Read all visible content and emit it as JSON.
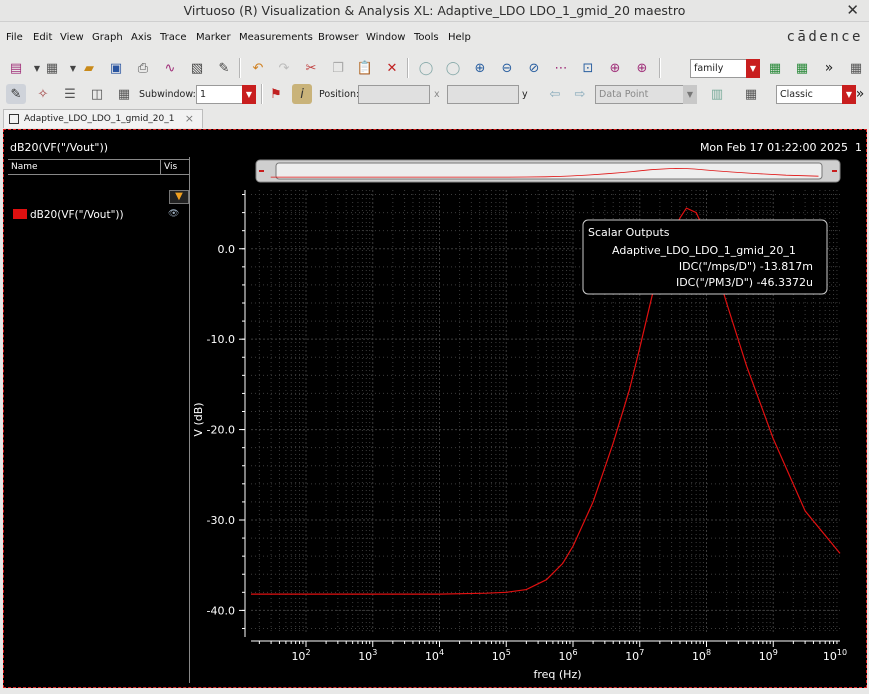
{
  "window": {
    "title": "Virtuoso (R) Visualization & Analysis XL: Adaptive_LDO LDO_1_gmid_20 maestro",
    "close_glyph": "✕"
  },
  "menu": {
    "items": [
      "File",
      "Edit",
      "View",
      "Graph",
      "Axis",
      "Trace",
      "Marker",
      "Measurements",
      "Browser",
      "Window",
      "Tools",
      "Help"
    ],
    "brand": "cādence"
  },
  "toolbar": {
    "family_combo": "family",
    "subwindow_label": "Subwindow:",
    "subwindow_value": "1",
    "position_label": "Position:",
    "x_label": "x",
    "y_label": "y",
    "marker_combo": "Data Point",
    "style_combo": "Classic",
    "overflow": "»"
  },
  "tab": {
    "label": "Adaptive_LDO_LDO_1_gmid_20_1",
    "close": "×"
  },
  "panel": {
    "header": "dB20(VF(\"/Vout\"))",
    "datetime": "Mon Feb 17 01:22:00 2025",
    "index": "1",
    "col_name": "Name",
    "col_vis": "Vis",
    "trace_name": "dB20(VF(\"/Vout\"))"
  },
  "scalar_outputs": {
    "title": "Scalar Outputs",
    "test": "Adaptive_LDO_LDO_1_gmid_20_1",
    "rows": [
      "IDC(\"/mps/D\") -13.817m",
      "IDC(\"/PM3/D\") -46.3372u"
    ]
  },
  "chart_data": {
    "type": "line",
    "title": "",
    "xlabel": "freq (Hz)",
    "ylabel": "V (dB)",
    "x_scale": "log",
    "xlim": [
      15,
      10000000000.0
    ],
    "ylim": [
      -42.5,
      6.5
    ],
    "x_ticks": [
      100.0,
      1000.0,
      10000.0,
      100000.0,
      1000000.0,
      10000000.0,
      100000000.0,
      1000000000.0,
      10000000000.0
    ],
    "x_tick_exponents": [
      "2",
      "3",
      "4",
      "5",
      "6",
      "7",
      "8",
      "9",
      "10"
    ],
    "x_tick_base": "10",
    "y_ticks": [
      0,
      -10,
      -20,
      -30,
      -40
    ],
    "y_tick_labels": [
      "0.0",
      "-10.0",
      "-20.0",
      "-30.0",
      "-40.0"
    ],
    "grid": true,
    "colors": {
      "background": "#000000",
      "trace": "#e01010",
      "axis": "#ffffff",
      "grid": "#3c3c3c"
    },
    "series": [
      {
        "name": "dB20(VF(\"/Vout\"))",
        "x": [
          15,
          100,
          1000,
          10000,
          50000,
          100000,
          200000,
          400000,
          700000,
          1000000,
          2000000,
          4000000,
          7000000,
          10000000,
          20000000,
          40000000,
          50000000,
          70000000,
          100000000,
          200000000,
          400000000,
          1000000000,
          3000000000,
          10000000000
        ],
        "y": [
          -38.2,
          -38.2,
          -38.2,
          -38.2,
          -38.1,
          -38.0,
          -37.7,
          -36.6,
          -34.8,
          -32.9,
          -28.0,
          -21.5,
          -15.6,
          -11.0,
          -1.6,
          3.4,
          4.5,
          4.0,
          1.5,
          -6.0,
          -13.0,
          -21.0,
          -29.0,
          -33.7
        ]
      }
    ]
  }
}
